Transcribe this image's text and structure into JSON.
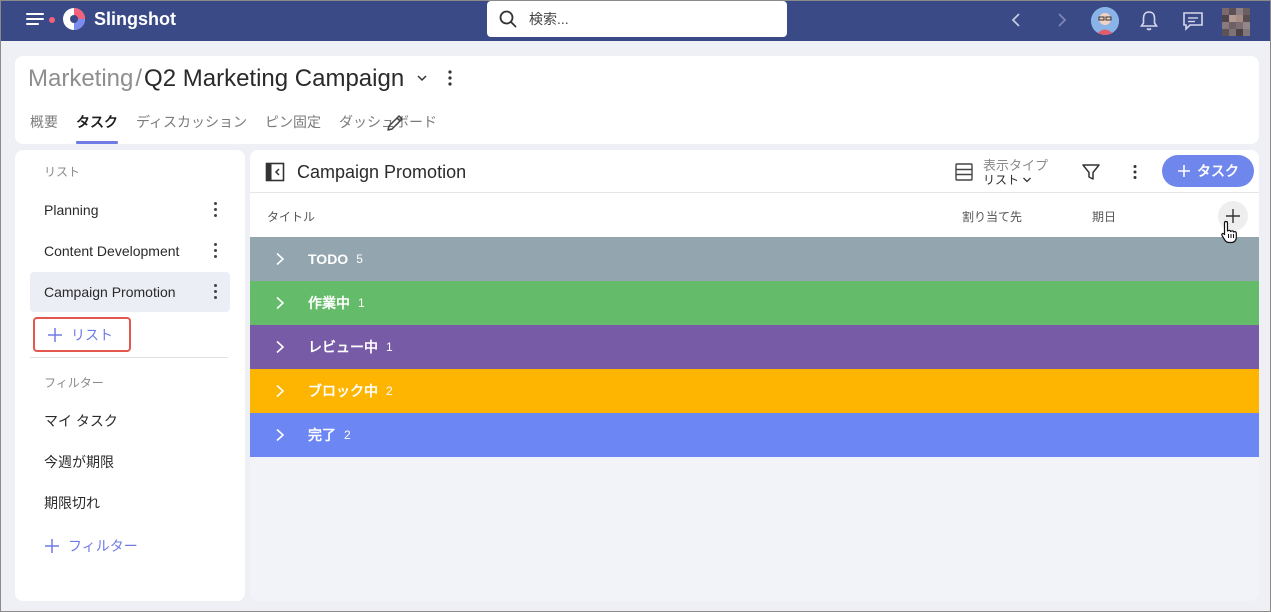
{
  "app": {
    "brand": "Slingshot",
    "search_placeholder": "検索..."
  },
  "header": {
    "breadcrumb_parent": "Marketing",
    "breadcrumb_sep": "/",
    "breadcrumb_current": "Q2 Marketing Campaign",
    "tabs": [
      {
        "label": "概要",
        "active": false
      },
      {
        "label": "タスク",
        "active": true
      },
      {
        "label": "ディスカッション",
        "active": false
      },
      {
        "label": "ピン固定",
        "active": false
      },
      {
        "label": "ダッシュボード",
        "active": false
      }
    ]
  },
  "sidebar": {
    "lists_heading": "リスト",
    "lists": [
      {
        "label": "Planning"
      },
      {
        "label": "Content Development"
      },
      {
        "label": "Campaign Promotion",
        "active": true
      }
    ],
    "add_list_label": "リスト",
    "filters_heading": "フィルター",
    "filters": [
      {
        "label": "マイ タスク"
      },
      {
        "label": "今週が期限"
      },
      {
        "label": "期限切れ"
      }
    ],
    "add_filter_label": "フィルター"
  },
  "main": {
    "title": "Campaign Promotion",
    "view_type_label": "表示タイプ",
    "view_type_value": "リスト",
    "add_task_label": "タスク",
    "columns": {
      "title": "タイトル",
      "assignee": "割り当て先",
      "due": "期日"
    },
    "groups": [
      {
        "name": "TODO",
        "count": "5",
        "color": "#93a5ae"
      },
      {
        "name": "作業中",
        "count": "1",
        "color": "#64bc6a"
      },
      {
        "name": "レビュー中",
        "count": "1",
        "color": "#775ba6"
      },
      {
        "name": "ブロック中",
        "count": "2",
        "color": "#fdb502"
      },
      {
        "name": "完了",
        "count": "2",
        "color": "#6c87f4"
      }
    ]
  },
  "colors": {
    "topbar": "#3a4a86",
    "accent": "#6f7ce6",
    "add_task_button": "#6f87ec",
    "highlight_border": "#e4574f"
  }
}
